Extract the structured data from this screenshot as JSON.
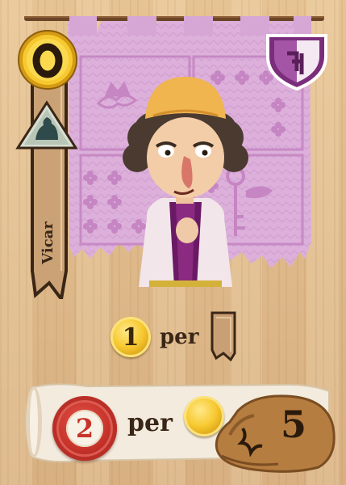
{
  "card": {
    "role_name": "Vicar",
    "rule_primary": {
      "coin_value": "1",
      "per_label": "per",
      "per_icon": "ribbon-token-icon"
    },
    "rule_secondary": {
      "seal_value": "2",
      "per_label": "per",
      "bag_number": "5"
    }
  },
  "colors": {
    "wood": "#dfbb8b",
    "banner": "#d9a9d8",
    "banner_pattern": "#c685c3",
    "coin_gold": "#f7c930",
    "seal_red": "#c43129",
    "scroll": "#f4ecdf",
    "bag": "#b07a3f",
    "text_dark": "#3a2616"
  },
  "icons": [
    "coin-icon",
    "triangle-badge-icon",
    "shield-icon",
    "key-icon",
    "crown-icon",
    "money-bag-icon",
    "ribbon-token-icon"
  ]
}
